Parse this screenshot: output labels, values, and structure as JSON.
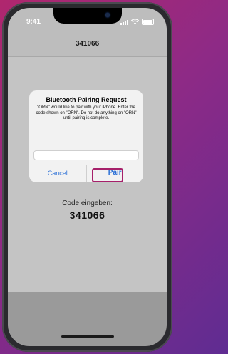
{
  "status_bar": {
    "time": "9:41"
  },
  "nav": {
    "title": "341066"
  },
  "alert": {
    "title": "Bluetooth Pairing Request",
    "message": "\"ORN\" would like to pair with your iPhone. Enter the code shown on \"ORN\". Do not do anything on \"ORN\" until pairing is complete.",
    "input_value": "",
    "cancel_label": "Cancel",
    "pair_label": "Pair"
  },
  "code_prompt": {
    "label": "Code eingeben:",
    "code": "341066"
  },
  "colors": {
    "accent": "#2a6fd6",
    "highlight": "#a6206a",
    "background_gradient_start": "#b0276e",
    "background_gradient_end": "#5f2c92"
  }
}
